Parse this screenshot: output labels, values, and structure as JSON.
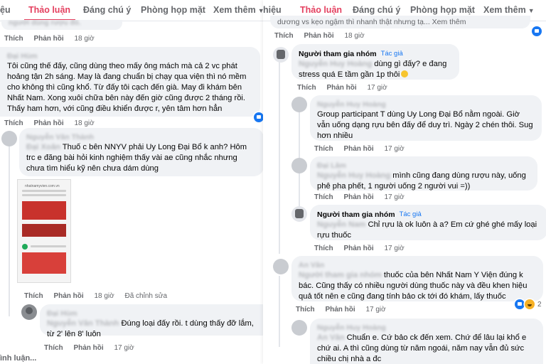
{
  "left": {
    "tabs": {
      "t1": "Thảo luận",
      "t2": "Đáng chú ý",
      "t3": "Phòng họp mặt",
      "t4": "Xem thêm"
    },
    "top_snippet": "người dùng rượu đó.",
    "top_actions": {
      "like": "Thích",
      "reply": "Phản hồi",
      "time": "18 giờ"
    },
    "c1": {
      "author": "Đại Hùm",
      "text": "Tôi cũng thế đấy, cũng dùng theo mấy ông mách mà cả 2 vc phát hoảng tận 2h sáng. May là đang chuẩn bị chạy qua viện thì nó mềm cho không thì cũng khổ. Từ đấy tôi cạch đến già. May đi khám bên Nhất Nam. Xong xuôi chữa bên này đến giờ cũng được 2 tháng rồi. Thấy ham hơn, với cũng điều khiển được r, yên tâm hơn hẳn",
      "actions": {
        "like": "Thích",
        "reply": "Phản hồi",
        "time": "18 giờ"
      }
    },
    "c2": {
      "author": "Nguyễn Văn Thành",
      "mention": "Đại Xoăn",
      "text": "Thuố c bên NNYV phải Uy Long Đại Bổ k anh? Hôm trc e đăng bài hỏi kinh nghiệm thấy vài ae cũng nhắc nhưng chưa tìm hiểu kỹ nên chưa dám dùng",
      "shot_url": "nhatnamyvien.com.vn",
      "actions": {
        "like": "Thích",
        "reply": "Phản hồi",
        "time": "18 giờ",
        "edited": "Đã chỉnh sửa"
      }
    },
    "c3": {
      "author": "Đại Hùm",
      "mention": "Nguyễn Văn Thành",
      "text": "Đúng loại đấy rồi. t dùng thấy đỡ lắm, từ 2' lên 8' luôn",
      "actions": {
        "like": "Thích",
        "reply": "Phản hồi",
        "time": "17 giờ"
      }
    },
    "footer": "ình luận..."
  },
  "right": {
    "tabs": {
      "t1": "hiệu",
      "t2": "Thảo luận",
      "t3": "Đáng chú ý",
      "t4": "Phòng họp mặt",
      "t5": "Xem thêm"
    },
    "top_snippet": "dương vs kẹo ngậm thì nhanh thật nhưng tạ... Xem thêm",
    "top_actions": {
      "like": "Thích",
      "reply": "Phản hồi",
      "time": "18 giờ"
    },
    "r1": {
      "author": "Người tham gia nhóm",
      "role": "Tác giả",
      "mention": "Nguyễn Huy Hoàng",
      "text": "dùng gì đấy? e đang stress quá E tầm gần 1p thôi",
      "actions": {
        "like": "Thích",
        "reply": "Phản hồi",
        "time": "17 giờ"
      }
    },
    "r2": {
      "author": "Nguyễn Huy Hoàng",
      "text": "Group participant T dùng Uy Long Đại Bổ nằm ngoài. Giờ vẫn uống dạng rựu bên đấy để duy trì. Ngày 2 chén thôi. Sug hơn nhiều",
      "actions": {
        "like": "Thích",
        "reply": "Phản hồi",
        "time": "17 giờ"
      }
    },
    "r3": {
      "author": "Đại Lâm",
      "mention": "Nguyễn Huy Hoàng",
      "text": "mình cũng đang dùng rượu này, uống phê pha phết, 1 người uống 2 người vui =))",
      "actions": {
        "like": "Thích",
        "reply": "Phản hồi",
        "time": "17 giờ"
      }
    },
    "r4": {
      "author": "Người tham gia nhóm",
      "role": "Tác giả",
      "mention": "Nguyễn Nam",
      "text": "Chỉ rựu là ok luôn à a? Em cứ ghé ghé mấy loại rựu thuốc",
      "actions": {
        "like": "Thích",
        "reply": "Phản hồi",
        "time": "17 giờ"
      }
    },
    "r5": {
      "author": "An Văn",
      "mention": "Người tham gia nhóm",
      "text": "thuốc của bên Nhất Nam Y Viện đúng k bác. Cũng thấy có nhiều người dùng thuốc này và đều khen hiệu quả tốt nên e cũng đang tính bảo ck tới đó khám, lấy thuốc",
      "actions": {
        "like": "Thích",
        "reply": "Phản hồi",
        "time": "17 giờ"
      },
      "react_count": "2"
    },
    "r6": {
      "author": "Nguyễn Huy Hoàng",
      "mention": "An Văn",
      "text": "Chuẩn e. Cứ bảo ck đến xem. Chứ để lâu lại khổ e chứ ai. A thì cũng dùng từ năm ngoái, năm nay vẫn đủ sức chiều chị nhà a đc"
    }
  }
}
